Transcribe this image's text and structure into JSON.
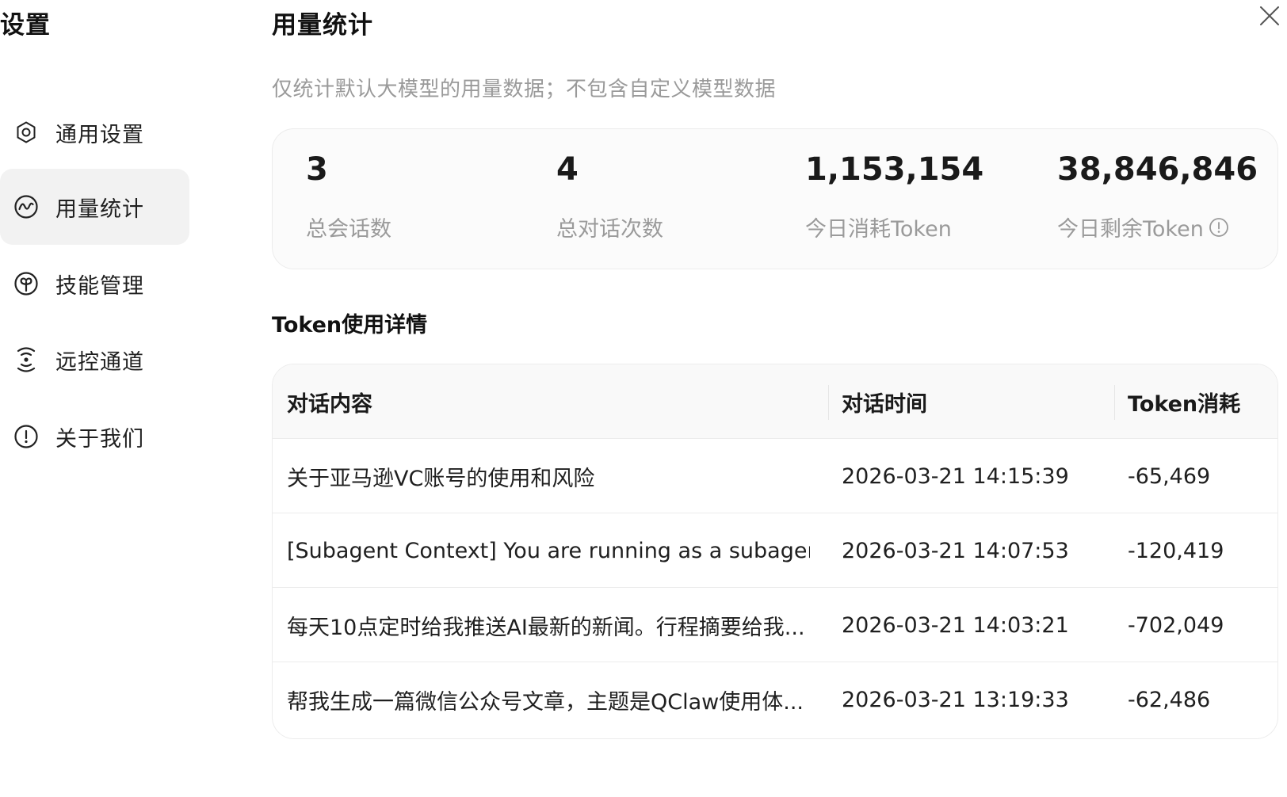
{
  "sidebar": {
    "title": "设置",
    "items": [
      {
        "label": "通用设置",
        "icon": "gear-icon"
      },
      {
        "label": "用量统计",
        "icon": "usage-chart-icon",
        "active": true
      },
      {
        "label": "技能管理",
        "icon": "skill-brain-icon"
      },
      {
        "label": "远控通道",
        "icon": "remote-signal-icon"
      },
      {
        "label": "关于我们",
        "icon": "info-circle-icon"
      }
    ]
  },
  "close": {
    "icon": "close-icon"
  },
  "main": {
    "title": "用量统计",
    "subtitle": "仅统计默认大模型的用量数据；不包含自定义模型数据",
    "stats": [
      {
        "value": "3",
        "caption": "总会话数"
      },
      {
        "value": "4",
        "caption": "总对话次数"
      },
      {
        "value": "1,153,154",
        "caption": "今日消耗Token"
      },
      {
        "value": "38,846,846",
        "caption": "今日剩余Token",
        "icon": "info-circle-icon"
      }
    ],
    "section_title": "Token使用详情",
    "table": {
      "headers": [
        "对话内容",
        "对话时间",
        "Token消耗"
      ],
      "rows": [
        {
          "content": "关于亚马逊VC账号的使用和风险",
          "time": "2026-03-21 14:15:39",
          "tokens": "-65,469"
        },
        {
          "content": "[Subagent Context] You are running as a subagen...",
          "time": "2026-03-21 14:07:53",
          "tokens": "-120,419"
        },
        {
          "content": "每天10点定时给我推送AI最新的新闻。行程摘要给我...",
          "time": "2026-03-21 14:03:21",
          "tokens": "-702,049"
        },
        {
          "content": "帮我生成一篇微信公众号文章，主题是QClaw使用体...",
          "time": "2026-03-21 13:19:33",
          "tokens": "-62,486"
        }
      ]
    }
  },
  "colors": {
    "active_bg": "#f2f2f2",
    "muted_text": "#9a9a9a",
    "border": "#ececec"
  }
}
